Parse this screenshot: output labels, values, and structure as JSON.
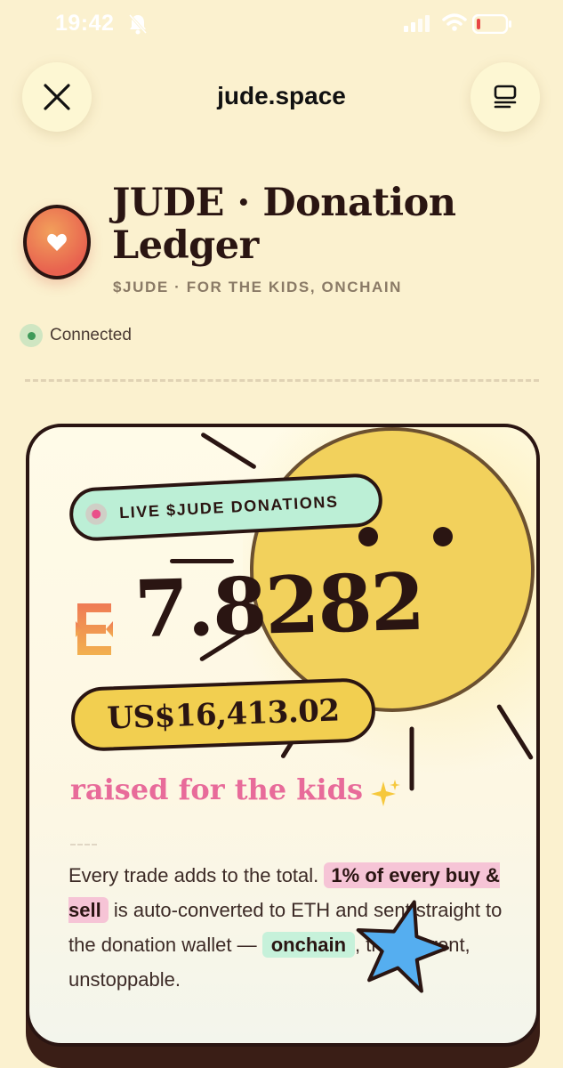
{
  "status_bar": {
    "time": "19:42"
  },
  "nav": {
    "title": "jude.space",
    "close_icon": "close-icon",
    "menu_icon": "tabs-icon"
  },
  "header": {
    "title_line1": "JUDE · Donation",
    "title_line2": "Ledger",
    "subtitle": "$JUDE · FOR THE KIDS, ONCHAIN",
    "status": "Connected",
    "logo_icon": "heart-icon"
  },
  "card": {
    "live_label": "LIVE $JUDE DONATIONS",
    "amount": "7.8282",
    "currency_icon": "eth-icon",
    "usd": "US$16,413.02",
    "raised": "raised for the kids",
    "body": {
      "part1": "Every trade adds to the total.",
      "highlight1": "1% of every buy & sell",
      "part2": "is auto-converted to ETH and sent straight to the donation wallet —",
      "highlight2": "onchain",
      "part3": ", transparent, unstoppable."
    }
  },
  "colors": {
    "background": "#fbf1cf",
    "ink": "#2a1512",
    "sun": "#f2d15c",
    "mint": "#bcefd6",
    "pink": "#e86b9a",
    "yellow_pill": "#f2cf50"
  }
}
